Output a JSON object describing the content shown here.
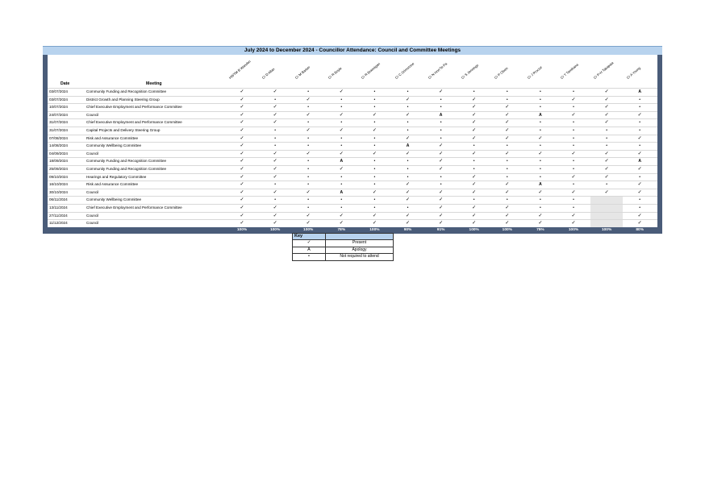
{
  "title": "July 2024 to December 2024 - Councillor Attendance: Council and Committee Meetings",
  "headers": {
    "date": "Date",
    "meeting": "Meeting"
  },
  "councillors": [
    "HWTM B Wanden",
    "Cr D Allan",
    "Cr M Barker",
    "Cr R Boyle",
    "Cr R Brannigan",
    "Cr C Grimstone",
    "Cr N Hon'Te Pa",
    "Cr S Jennings",
    "Cr P Olsen",
    "Cr J Proctor",
    "Cr T Tamihana",
    "Cr P-H Takapaia",
    "Cr A Young"
  ],
  "rows": [
    {
      "date": "03/07/2024",
      "meeting": "Community Funding and Recognition Committee",
      "marks": [
        "✓",
        "✓",
        "•",
        "✓",
        "•",
        "•",
        "✓",
        "•",
        "•",
        "•",
        "•",
        "✓",
        "A"
      ]
    },
    {
      "date": "03/07/2024",
      "meeting": "District Growth and Planning Steering Group",
      "marks": [
        "✓",
        "•",
        "✓",
        "•",
        "•",
        "✓",
        "•",
        "✓",
        "•",
        "•",
        "✓",
        "✓",
        "•"
      ]
    },
    {
      "date": "10/07/2024",
      "meeting": "Chief Executive Employment and Performance Committee",
      "marks": [
        "✓",
        "✓",
        "•",
        "•",
        "•",
        "•",
        "•",
        "✓",
        "✓",
        "•",
        "•",
        "✓",
        "•"
      ]
    },
    {
      "date": "24/07/2024",
      "meeting": "Council",
      "marks": [
        "✓",
        "✓",
        "✓",
        "✓",
        "✓",
        "✓",
        "A",
        "✓",
        "✓",
        "A",
        "✓",
        "✓",
        "✓"
      ]
    },
    {
      "date": "31/07/2024",
      "meeting": "Chief Executive Employment and Performance Committee",
      "marks": [
        "✓",
        "✓",
        "•",
        "•",
        "•",
        "•",
        "•",
        "✓",
        "✓",
        "•",
        "•",
        "✓",
        "•"
      ]
    },
    {
      "date": "31/07/2024",
      "meeting": "Capital Projects and Delivery Steering Group",
      "marks": [
        "✓",
        "•",
        "✓",
        "✓",
        "✓",
        "•",
        "•",
        "✓",
        "✓",
        "•",
        "•",
        "•",
        "•"
      ]
    },
    {
      "date": "07/08/2024",
      "meeting": "Risk and Assurance Committee",
      "marks": [
        "✓",
        "•",
        "•",
        "•",
        "•",
        "✓",
        "•",
        "✓",
        "✓",
        "✓",
        "•",
        "•",
        "✓"
      ]
    },
    {
      "date": "14/08/2024",
      "meeting": "Community Wellbeing Committee",
      "marks": [
        "✓",
        "•",
        "•",
        "•",
        "•",
        "A",
        "✓",
        "•",
        "•",
        "•",
        "•",
        "•",
        "•"
      ]
    },
    {
      "date": "04/09/2024",
      "meeting": "Council",
      "marks": [
        "✓",
        "✓",
        "✓",
        "✓",
        "✓",
        "✓",
        "✓",
        "✓",
        "✓",
        "✓",
        "✓",
        "✓",
        "✓"
      ]
    },
    {
      "date": "18/09/2024",
      "meeting": "Community Funding and Recognition Committee",
      "marks": [
        "✓",
        "✓",
        "•",
        "A",
        "•",
        "•",
        "✓",
        "•",
        "•",
        "•",
        "•",
        "✓",
        "A"
      ]
    },
    {
      "date": "25/09/2024",
      "meeting": "Community Funding and Recognition Committee",
      "marks": [
        "✓",
        "✓",
        "•",
        "✓",
        "•",
        "•",
        "✓",
        "•",
        "•",
        "•",
        "•",
        "✓",
        "✓"
      ]
    },
    {
      "date": "09/10/2024",
      "meeting": "Hearings and Regulatory Committee",
      "marks": [
        "✓",
        "✓",
        "•",
        "•",
        "•",
        "•",
        "•",
        "✓",
        "•",
        "•",
        "✓",
        "✓",
        "•"
      ]
    },
    {
      "date": "16/10/2024",
      "meeting": "Risk and Assurance Committee",
      "marks": [
        "✓",
        "•",
        "•",
        "•",
        "•",
        "✓",
        "•",
        "✓",
        "✓",
        "A",
        "•",
        "•",
        "✓"
      ]
    },
    {
      "date": "30/10/2024",
      "meeting": "Council",
      "marks": [
        "✓",
        "✓",
        "✓",
        "A",
        "✓",
        "✓",
        "✓",
        "✓",
        "✓",
        "✓",
        "✓",
        "✓",
        "✓"
      ]
    },
    {
      "date": "06/11/2024",
      "meeting": "Community Wellbeing Committee",
      "marks": [
        "✓",
        "•",
        "•",
        "•",
        "•",
        "✓",
        "✓",
        "•",
        "•",
        "•",
        "•",
        "",
        "•"
      ]
    },
    {
      "date": "13/11/2024",
      "meeting": "Chief Executive Employment and Performance Committee",
      "marks": [
        "✓",
        "✓",
        "•",
        "•",
        "•",
        "•",
        "✓",
        "✓",
        "✓",
        "•",
        "•",
        "",
        "•"
      ]
    },
    {
      "date": "27/11/2024",
      "meeting": "Council",
      "marks": [
        "✓",
        "✓",
        "✓",
        "✓",
        "✓",
        "✓",
        "✓",
        "✓",
        "✓",
        "✓",
        "✓",
        "",
        "✓"
      ]
    },
    {
      "date": "11/12/2024",
      "meeting": "Council",
      "marks": [
        "✓",
        "✓",
        "✓",
        "✓",
        "✓",
        "✓",
        "✓",
        "✓",
        "✓",
        "✓",
        "✓",
        "",
        "✓"
      ]
    }
  ],
  "percentages": [
    "100%",
    "100%",
    "100%",
    "78%",
    "100%",
    "90%",
    "91%",
    "100%",
    "100%",
    "75%",
    "100%",
    "100%",
    "80%"
  ],
  "key": {
    "heading": "Key",
    "items": [
      {
        "symbol": "✓",
        "label": "Present"
      },
      {
        "symbol": "A",
        "label": "Apology"
      },
      {
        "symbol": "•",
        "label": "Not required to attend"
      }
    ]
  }
}
